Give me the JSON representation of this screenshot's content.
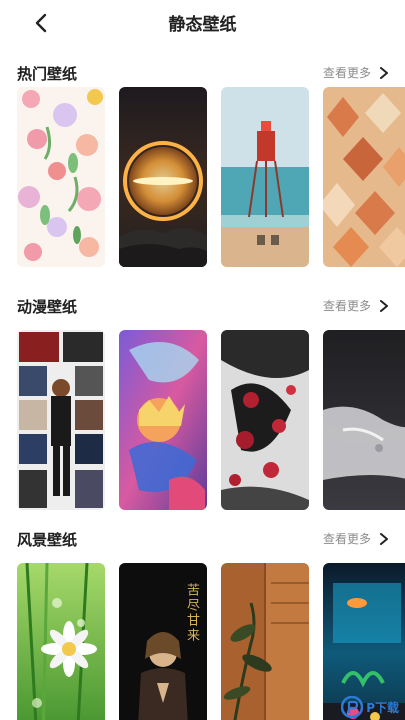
{
  "header": {
    "title": "静态壁纸"
  },
  "sections": [
    {
      "title": "热门壁纸",
      "more": "查看更多"
    },
    {
      "title": "动漫壁纸",
      "more": "查看更多"
    },
    {
      "title": "风景壁纸",
      "more": "查看更多"
    }
  ],
  "thumbs_row1": [
    {
      "name": "floral-pattern"
    },
    {
      "name": "sunset-ring"
    },
    {
      "name": "beach-lifeguard-tower"
    },
    {
      "name": "autumn-leaves"
    }
  ],
  "thumbs_row2": [
    {
      "name": "anime-collage"
    },
    {
      "name": "anime-colorful"
    },
    {
      "name": "anime-red-black"
    },
    {
      "name": "anime-white-hair"
    }
  ],
  "thumbs_row3": [
    {
      "name": "green-daisy"
    },
    {
      "name": "girl-praying",
      "text": "苦尽甘来"
    },
    {
      "name": "plant-shadow"
    },
    {
      "name": "aquarium"
    }
  ],
  "watermark": {
    "text": "P下载"
  }
}
